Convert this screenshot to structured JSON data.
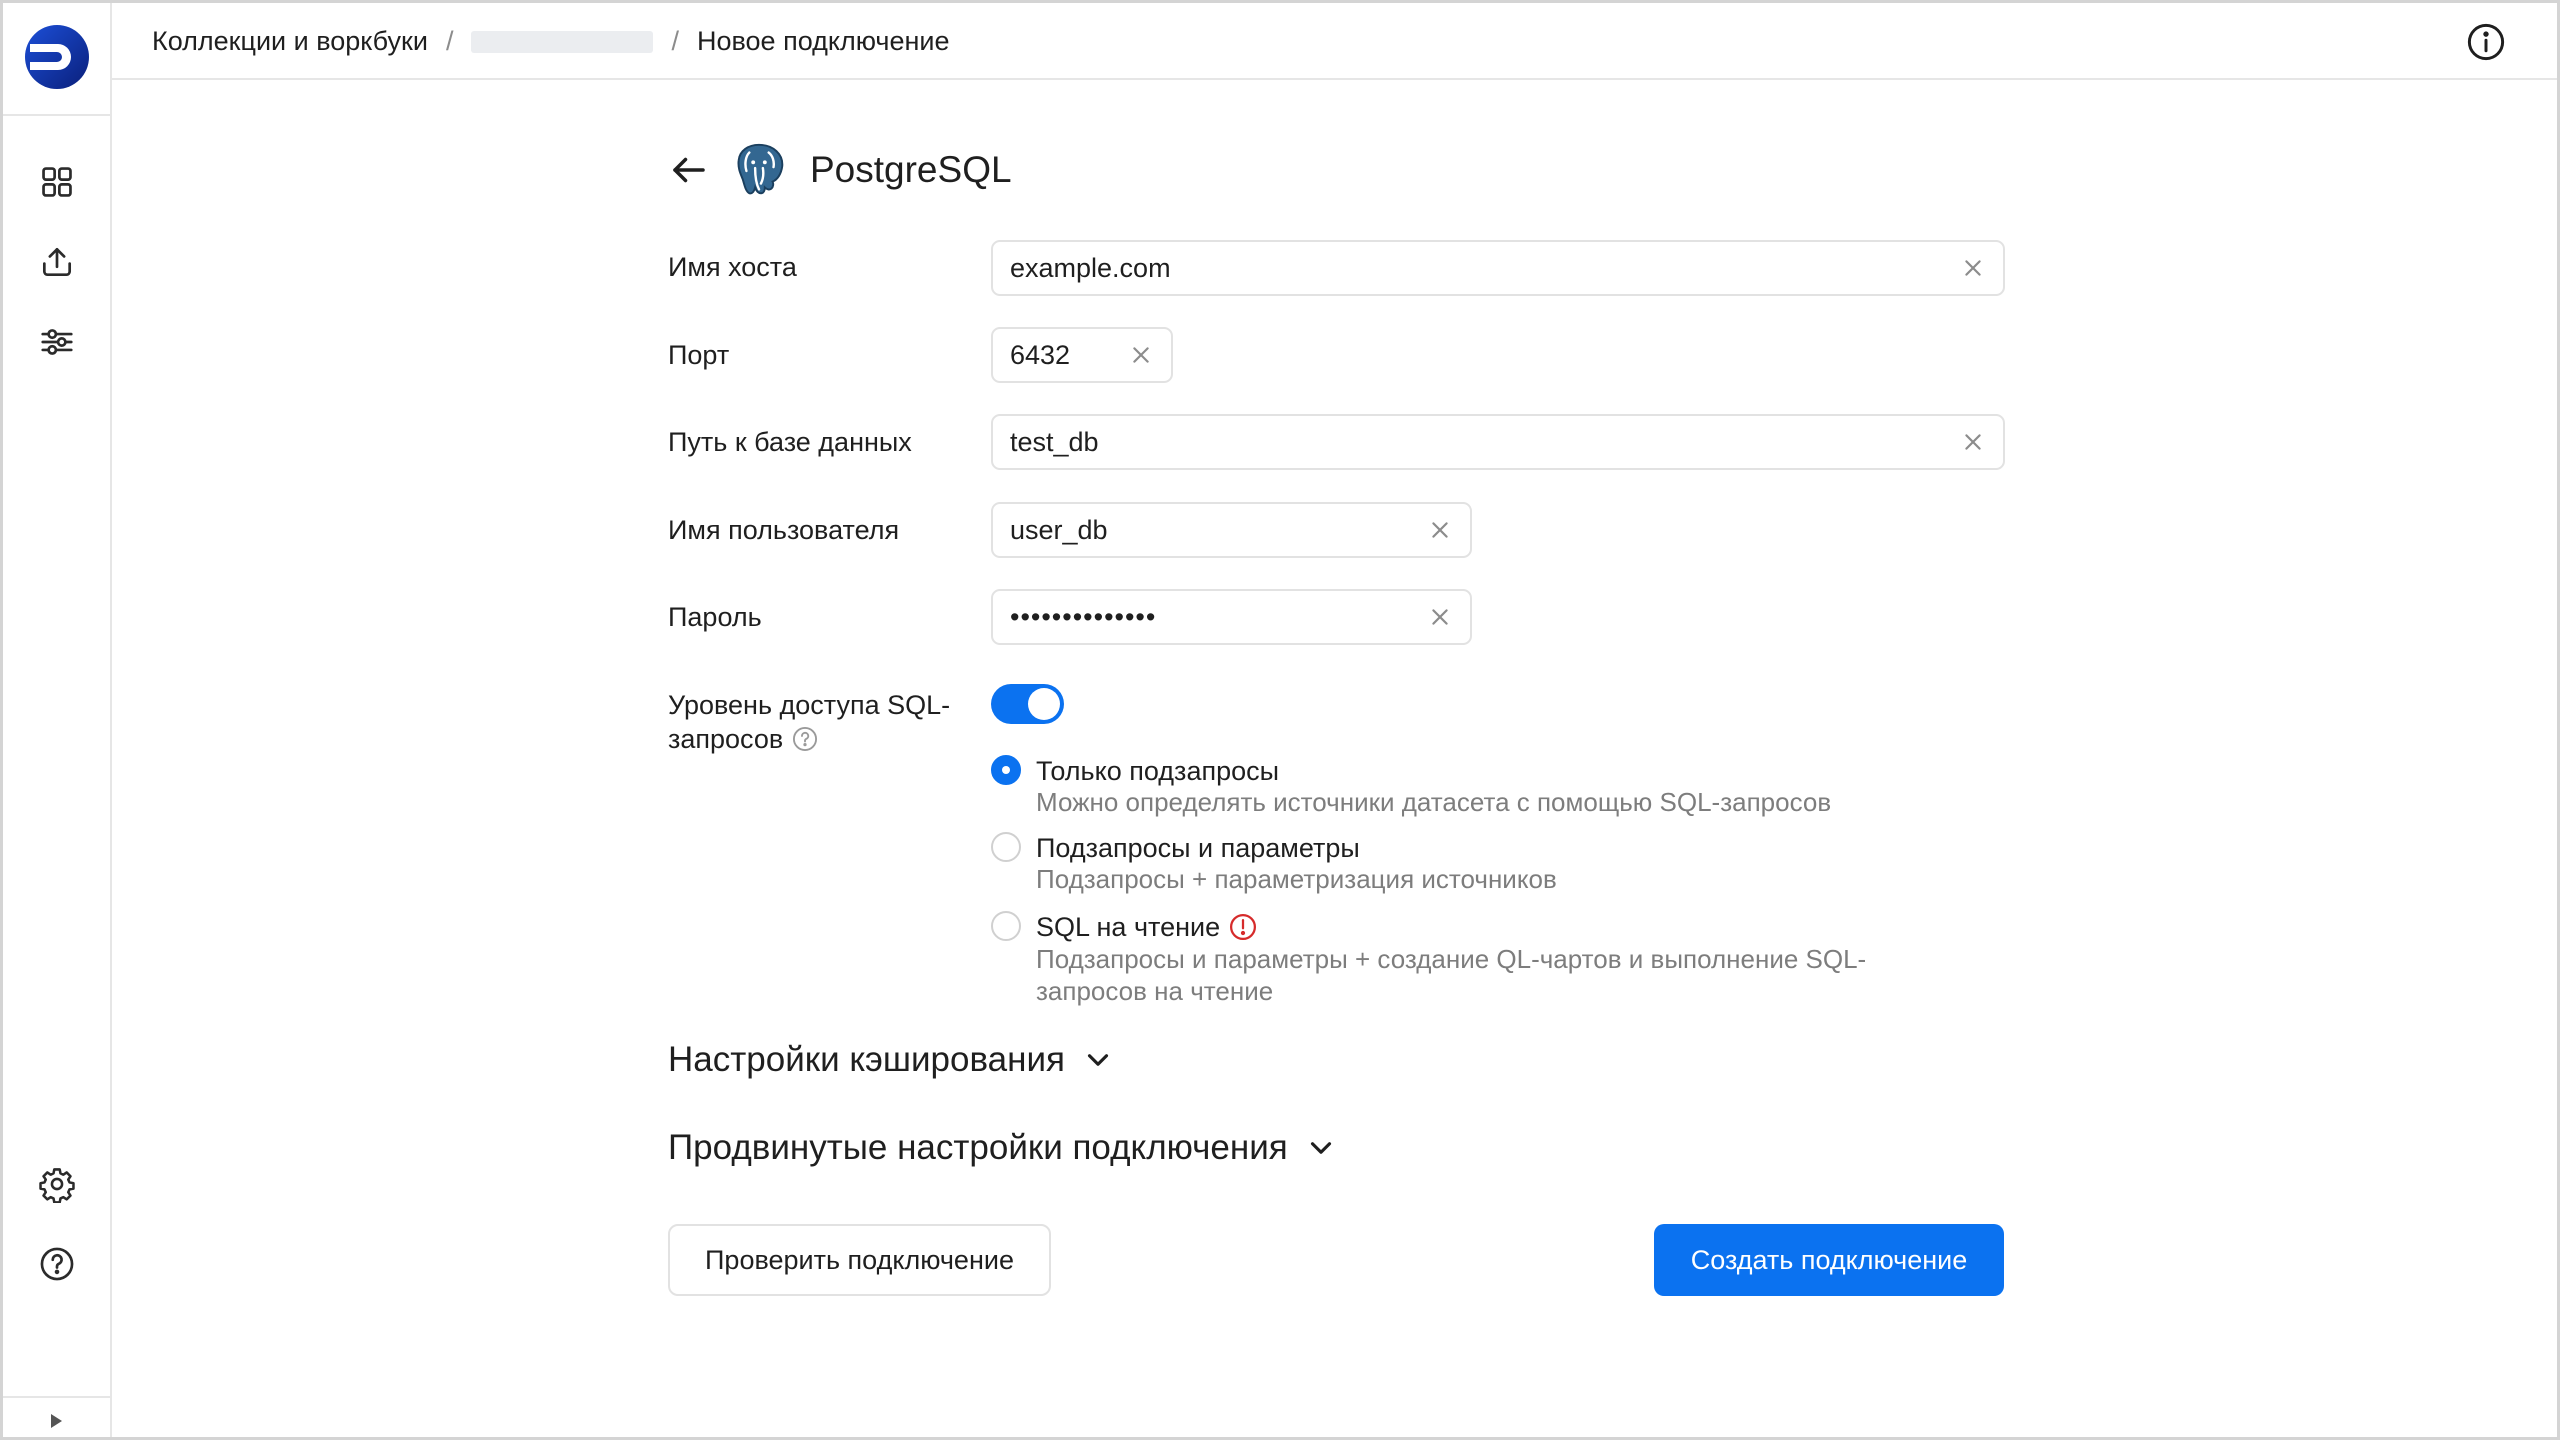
{
  "header": {
    "breadcrumb": [
      {
        "label": "Коллекции и воркбуки"
      },
      {
        "label": ""
      },
      {
        "label": "Новое подключение"
      }
    ],
    "separator": "/"
  },
  "sidebar": {
    "items": [
      {
        "icon": "grid-icon"
      },
      {
        "icon": "upload-icon"
      },
      {
        "icon": "sliders-icon"
      }
    ],
    "bottom": [
      {
        "icon": "gear-icon"
      },
      {
        "icon": "help-circle-icon"
      }
    ],
    "collapse_icon": "play-triangle-icon"
  },
  "connector": {
    "title": "PostgreSQL",
    "icon": "postgresql-elephant-icon"
  },
  "form": {
    "host": {
      "label": "Имя хоста",
      "value": "example.com"
    },
    "port": {
      "label": "Порт",
      "value": "6432"
    },
    "db_path": {
      "label": "Путь к базе данных",
      "value": "test_db"
    },
    "username": {
      "label": "Имя пользователя",
      "value": "user_db"
    },
    "password": {
      "label": "Пароль",
      "value": "••••••••••••••"
    },
    "sql_level": {
      "label_line1": "Уровень доступа SQL-",
      "label_line2": "запросов",
      "enabled": true,
      "options": [
        {
          "title": "Только подзапросы",
          "desc": "Можно определять источники датасета с помощью SQL-запросов",
          "selected": true
        },
        {
          "title": "Подзапросы и параметры",
          "desc": "Подзапросы + параметризация источников",
          "selected": false
        },
        {
          "title": "SQL на чтение",
          "desc": "Подзапросы и параметры + создание QL-чартов и выполнение SQL-запросов на чтение",
          "selected": false
        }
      ]
    },
    "cache_section": "Настройки кэширования",
    "advanced_section": "Продвинутые настройки подключения"
  },
  "actions": {
    "check_label": "Проверить подключение",
    "create_label": "Создать подключение"
  },
  "colors": {
    "accent": "#0b72f0",
    "warning": "#d62b2b",
    "muted_text": "#7d7d7d"
  }
}
